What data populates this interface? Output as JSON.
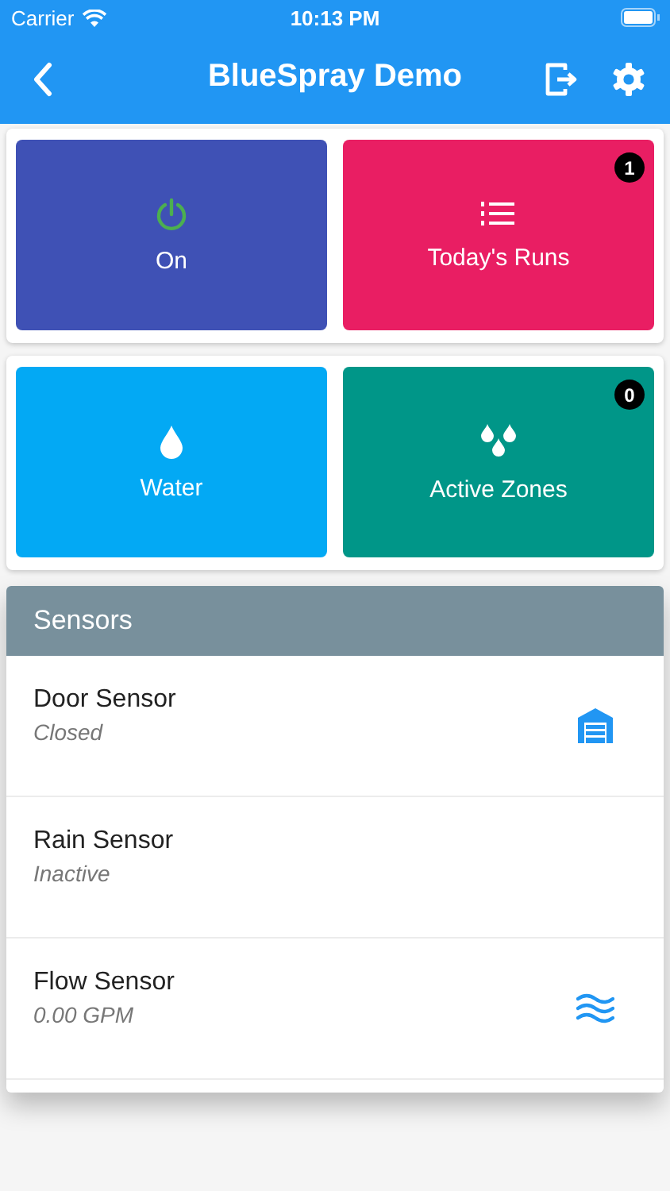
{
  "status_bar": {
    "carrier": "Carrier",
    "time": "10:13 PM"
  },
  "nav": {
    "title": "BlueSpray Demo"
  },
  "tile_groups": [
    {
      "tiles": [
        {
          "kind": "power",
          "label": "On",
          "color": "#3f51b5"
        },
        {
          "kind": "list",
          "label": "Today's Runs",
          "color": "#e91e63",
          "badge": "1"
        }
      ]
    },
    {
      "tiles": [
        {
          "kind": "drop",
          "label": "Water",
          "color": "#03a9f4"
        },
        {
          "kind": "drops",
          "label": "Active Zones",
          "color": "#009688",
          "badge": "0"
        }
      ]
    }
  ],
  "sensors": {
    "title": "Sensors",
    "rows": [
      {
        "name": "Door Sensor",
        "status": "Closed",
        "kind": "garage"
      },
      {
        "name": "Rain Sensor",
        "status": "Inactive",
        "kind": "none"
      },
      {
        "name": "Flow Sensor",
        "status": "0.00 GPM",
        "kind": "waves"
      }
    ]
  }
}
